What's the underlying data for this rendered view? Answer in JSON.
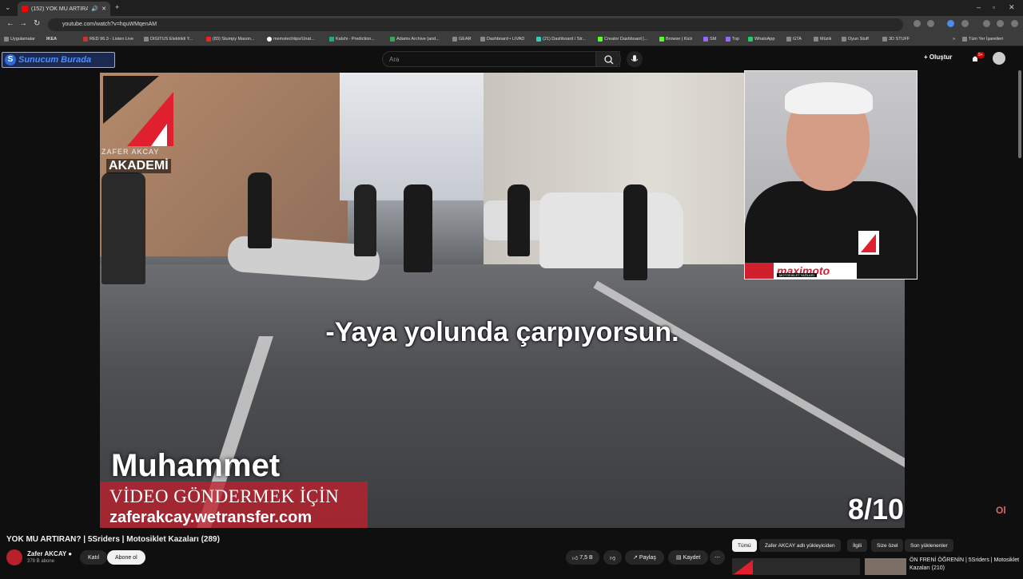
{
  "browser": {
    "tab_title": "(152) YOK MU ARTIRAN? | 5",
    "url": "youtube.com/watch?v=hquWMqenAM",
    "bookmarks": [
      "Uygulamalar",
      "IKEA",
      "RED 96.3 - Listen Live",
      "DIGITUS Elektrikli Y...",
      "(83) Stumpy Mason...",
      "memstechtips/Unat...",
      "Kalshi - Prediction...",
      "Adams Archive (and...",
      "GEAR",
      "Dashboard • LIVAD",
      "(21) Dashboard / Str...",
      "Creator Dashboard |...",
      "Browse | Kick",
      "SM",
      "Top",
      "WhatsApp",
      "GTA",
      "Müzik",
      "Oyun Stuff",
      "3D STUFF"
    ],
    "all_bookmarks": "Tüm Yer İşaretleri"
  },
  "youtube": {
    "logo_text": "Sunucum Burada",
    "search_placeholder": "Ara",
    "create_label": "Oluştur",
    "notif_count": "9+"
  },
  "video": {
    "brand_name": "ZAFER AKCAY",
    "brand_sub": "AKADEMİ",
    "subtitle": "-Yaya yolunda çarpıyorsun.",
    "sender_name": "Muhammet",
    "send_line1": "VİDEO GÖNDERMEK İÇİN",
    "send_line2": "zaferakcay.wetransfer.com",
    "counter": "8/10",
    "pip_brand": "maximoto",
    "pip_brand_sub": "MOTOSİKLET YAĞLARI"
  },
  "info": {
    "title": "YOK MU ARTIRAN? | 5Sriders | Motosiklet Kazaları (289)",
    "channel": "Zafer AKCAY",
    "subscribers": "378 B abone",
    "join_label": "Katıl",
    "subscribe_label": "Abone ol",
    "likes": "7,5 B",
    "share_label": "Paylaş",
    "save_label": "Kaydet"
  },
  "related": {
    "chips": [
      "Tümü",
      "Zafer AKCAY adlı yükleyiciden",
      "İlgili",
      "Size özel",
      "Son yüklenenler"
    ],
    "first_title": "ÖN FRENİ ÖĞRENİN | 5Sriders | Motosiklet Kazaları (210)"
  }
}
